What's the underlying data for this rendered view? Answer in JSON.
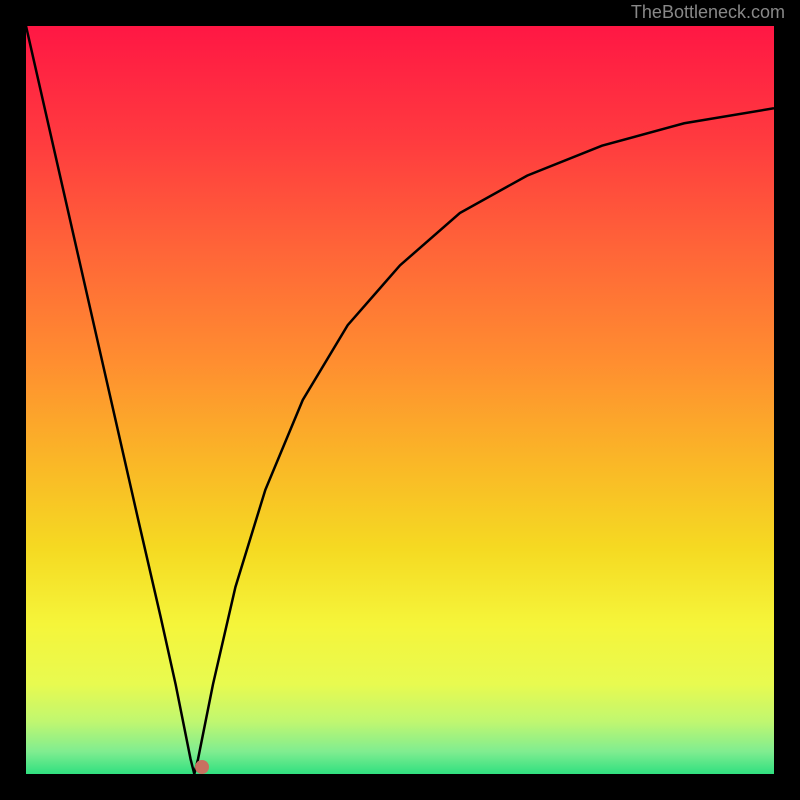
{
  "watermark": "TheBottleneck.com",
  "chart_data": {
    "type": "line",
    "title": "",
    "xlabel": "",
    "ylabel": "",
    "xlim": [
      0,
      100
    ],
    "ylim": [
      0,
      100
    ],
    "curve_points": [
      {
        "x": 0,
        "y": 100
      },
      {
        "x": 5,
        "y": 78
      },
      {
        "x": 10,
        "y": 56
      },
      {
        "x": 15,
        "y": 34
      },
      {
        "x": 18,
        "y": 21
      },
      {
        "x": 20,
        "y": 12
      },
      {
        "x": 22,
        "y": 2
      },
      {
        "x": 22.5,
        "y": 0
      },
      {
        "x": 23,
        "y": 2
      },
      {
        "x": 25,
        "y": 12
      },
      {
        "x": 28,
        "y": 25
      },
      {
        "x": 32,
        "y": 38
      },
      {
        "x": 37,
        "y": 50
      },
      {
        "x": 43,
        "y": 60
      },
      {
        "x": 50,
        "y": 68
      },
      {
        "x": 58,
        "y": 75
      },
      {
        "x": 67,
        "y": 80
      },
      {
        "x": 77,
        "y": 84
      },
      {
        "x": 88,
        "y": 87
      },
      {
        "x": 100,
        "y": 89
      }
    ],
    "marker": {
      "x": 23.5,
      "y": 1
    },
    "gradient_stops": [
      {
        "offset": 0,
        "color": "#ff1744"
      },
      {
        "offset": 15,
        "color": "#ff3a3f"
      },
      {
        "offset": 30,
        "color": "#ff6538"
      },
      {
        "offset": 45,
        "color": "#ff8e30"
      },
      {
        "offset": 58,
        "color": "#fab627"
      },
      {
        "offset": 70,
        "color": "#f5da22"
      },
      {
        "offset": 80,
        "color": "#f5f53a"
      },
      {
        "offset": 88,
        "color": "#e8fa50"
      },
      {
        "offset": 93,
        "color": "#c0f770"
      },
      {
        "offset": 97,
        "color": "#80ed90"
      },
      {
        "offset": 100,
        "color": "#30e080"
      }
    ]
  }
}
